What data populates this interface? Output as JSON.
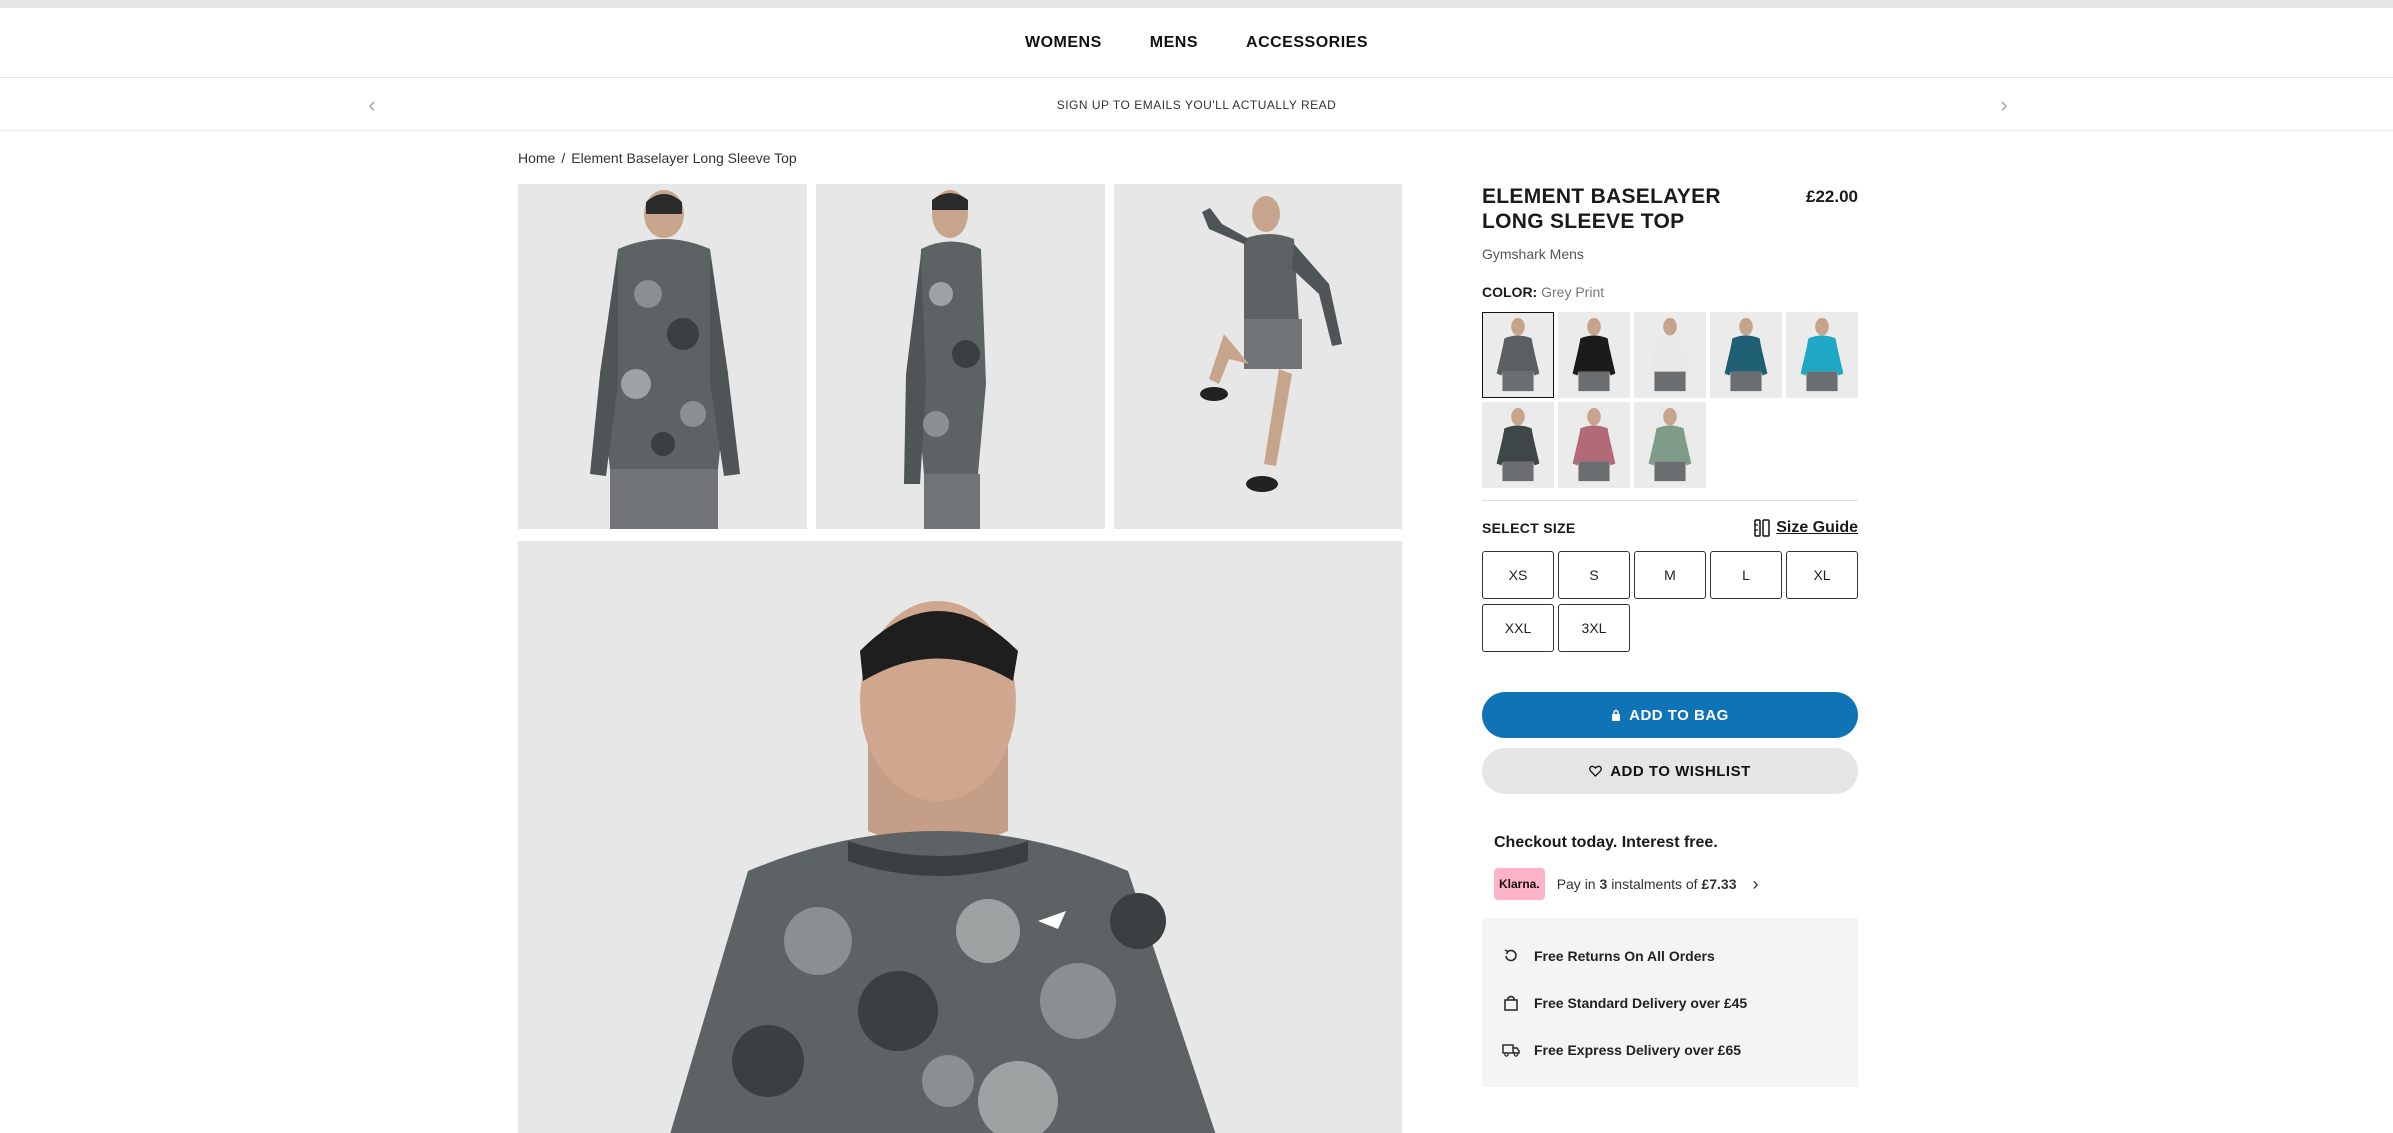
{
  "nav": {
    "items": [
      {
        "label": "WOMENS"
      },
      {
        "label": "MENS"
      },
      {
        "label": "ACCESSORIES"
      }
    ]
  },
  "promo": {
    "message": "SIGN UP TO EMAILS YOU'LL ACTUALLY READ",
    "prev_icon": "chevron-left-icon",
    "next_icon": "chevron-right-icon"
  },
  "breadcrumb": {
    "home": "Home",
    "separator": "/",
    "current": "Element Baselayer Long Sleeve Top"
  },
  "product": {
    "title": "ELEMENT BASELAYER LONG SLEEVE TOP",
    "price": "£22.00",
    "brand": "Gymshark Mens",
    "color_label": "COLOR:",
    "color_value": "Grey Print",
    "swatch_colors": [
      "#5a5f62",
      "#1b1b1b",
      "#e9e9e9",
      "#1f5f73",
      "#1fa8c4",
      "#3f4648",
      "#b26a78",
      "#7f9c8a"
    ],
    "size_label": "SELECT SIZE",
    "size_guide": "Size Guide",
    "sizes": [
      "XS",
      "S",
      "M",
      "L",
      "XL",
      "XXL",
      "3XL"
    ],
    "add_to_bag": "ADD TO BAG",
    "add_to_wishlist": "ADD TO WISHLIST"
  },
  "klarna": {
    "headline": "Checkout today. Interest free.",
    "badge": "Klarna.",
    "pay_in": "Pay in",
    "count": "3",
    "instalments_of": "instalments of",
    "amount": "£7.33"
  },
  "perks": [
    {
      "icon": "return-icon",
      "label": "Free Returns On All Orders"
    },
    {
      "icon": "bag-icon",
      "label": "Free Standard Delivery over £45"
    },
    {
      "icon": "truck-icon",
      "label": "Free Express Delivery over £65"
    }
  ],
  "colors": {
    "primary_button": "#1073b5",
    "secondary_button": "#e5e5e5",
    "klarna_pink": "#ffb3c7"
  }
}
